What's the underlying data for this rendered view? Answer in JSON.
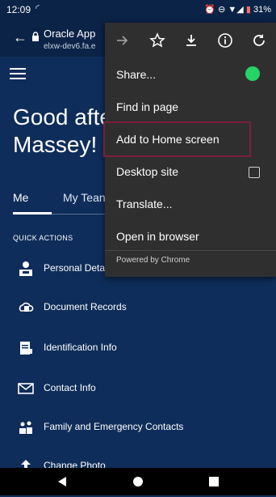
{
  "status_bar": {
    "time": "12:09",
    "battery": "31%"
  },
  "browser": {
    "tab_title": "Oracle App",
    "url_host": "elxw-dev6.fa.e"
  },
  "page": {
    "greeting_line1": "Good afte",
    "greeting_line2": "Massey!",
    "tabs": [
      "Me",
      "My Tean"
    ],
    "quick_actions_heading": "QUICK ACTIONS",
    "quick_actions": [
      {
        "label": "Personal Detail",
        "icon": "person-id-icon"
      },
      {
        "label": "Document Records",
        "icon": "cloud-doc-icon"
      },
      {
        "label": "Identification Info",
        "icon": "id-card-icon"
      },
      {
        "label": "Contact Info",
        "icon": "envelope-icon"
      },
      {
        "label": "Family and Emergency Contacts",
        "icon": "family-icon"
      },
      {
        "label": "Change Photo",
        "icon": "upload-icon"
      }
    ]
  },
  "menu": {
    "items": [
      {
        "label": "Share..."
      },
      {
        "label": "Find in page"
      },
      {
        "label": "Add to Home screen",
        "highlighted": true
      },
      {
        "label": "Desktop site",
        "checkbox": false
      },
      {
        "label": "Translate..."
      },
      {
        "label": "Open in browser"
      }
    ],
    "footer": "Powered by Chrome",
    "colors": {
      "menu_bg": "#2f2f2f",
      "highlight_outline": "#7b1f3b",
      "whatsapp_green": "#25D366"
    }
  }
}
